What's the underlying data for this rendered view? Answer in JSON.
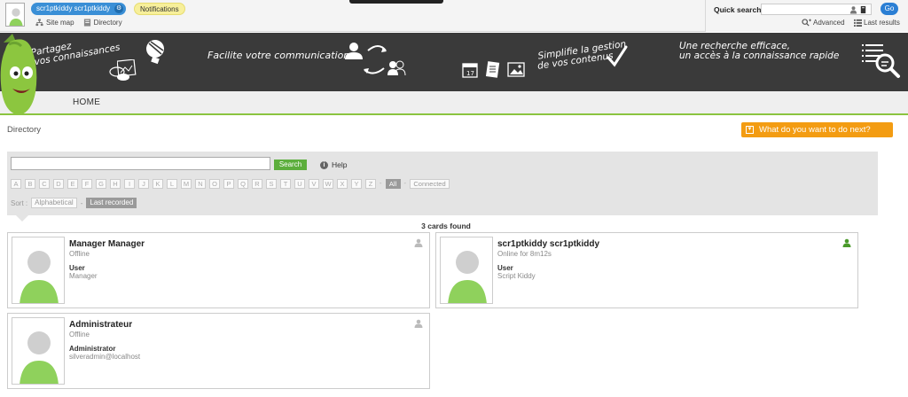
{
  "topbar": {
    "user_name": "scr1ptkiddy scr1ptkiddy",
    "notifications_label": "Notifications",
    "site_map_label": "Site map",
    "directory_label": "Directory"
  },
  "quick_search": {
    "label": "Quick search",
    "value": "",
    "go_label": "Go",
    "advanced_label": "Advanced",
    "last_results_label": "Last results"
  },
  "banner": {
    "tagline1_line1": "Partagez",
    "tagline1_line2": "vos connaissances",
    "tagline2": "Facilite votre communication",
    "tagline3_line1": "Simplifie la gestion",
    "tagline3_line2": "de vos contenus",
    "tagline4_line1": "Une recherche efficace,",
    "tagline4_line2": "un accès à la connaissance rapide",
    "calendar_day": "17"
  },
  "nav": {
    "home_label": "HOME"
  },
  "page": {
    "breadcrumb": "Directory",
    "next_label": "What do you want to do next?"
  },
  "directory": {
    "search_value": "",
    "search_button": "Search",
    "help_label": "Help",
    "letters": [
      "A",
      "B",
      "C",
      "D",
      "E",
      "F",
      "G",
      "H",
      "I",
      "J",
      "K",
      "L",
      "M",
      "N",
      "O",
      "P",
      "Q",
      "R",
      "S",
      "T",
      "U",
      "V",
      "W",
      "X",
      "Y",
      "Z"
    ],
    "all_label": "All",
    "connected_label": "Connected",
    "sort_label": "Sort :",
    "sort_alpha": "Alphabetical",
    "sort_last": "Last recorded",
    "count_label": "3 cards found"
  },
  "cards": [
    {
      "name": "Manager Manager",
      "status": "Offline",
      "role": "User",
      "detail": "Manager",
      "online": false
    },
    {
      "name": "scr1ptkiddy scr1ptkiddy",
      "status": "Online for 8m12s",
      "role": "User",
      "detail": "Script Kiddy",
      "online": true
    },
    {
      "name": "Administrateur",
      "status": "Offline",
      "role": "Administrator",
      "detail": "silveradmin@localhost",
      "online": false
    }
  ],
  "colors": {
    "accent_blue": "#3a8fd6",
    "green": "#8bc43f",
    "orange": "#f39c12",
    "banner": "#3a3a3a"
  }
}
